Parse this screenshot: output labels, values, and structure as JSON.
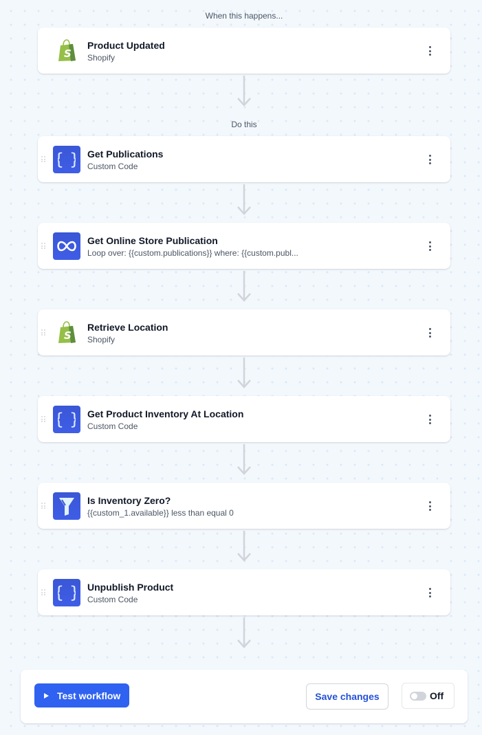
{
  "trigger_section": {
    "label": "When this happens...",
    "card": {
      "title": "Product Updated",
      "subtitle": "Shopify",
      "icon": "shopify-icon"
    }
  },
  "actions_section": {
    "label": "Do this",
    "steps": [
      {
        "title": "Get Publications",
        "subtitle": "Custom Code",
        "icon": "code-braces-icon"
      },
      {
        "title": "Get Online Store Publication",
        "subtitle": "Loop over: {{custom.publications}} where: {{custom.publ...",
        "icon": "loop-icon"
      },
      {
        "title": "Retrieve Location",
        "subtitle": "Shopify",
        "icon": "shopify-icon"
      },
      {
        "title": "Get Product Inventory At Location",
        "subtitle": "Custom Code",
        "icon": "code-braces-icon"
      },
      {
        "title": "Is Inventory Zero?",
        "subtitle": "{{custom_1.available}} less than equal 0",
        "icon": "filter-icon"
      },
      {
        "title": "Unpublish Product",
        "subtitle": "Custom Code",
        "icon": "code-braces-icon"
      }
    ]
  },
  "footer": {
    "test_label": "Test workflow",
    "save_label": "Save changes",
    "toggle_label": "Off",
    "toggle_on": false
  },
  "colors": {
    "primary": "#2f62f0",
    "icon_bg": "#3a57d6",
    "shopify_green": "#95bf47",
    "background": "#f3f8fd"
  }
}
